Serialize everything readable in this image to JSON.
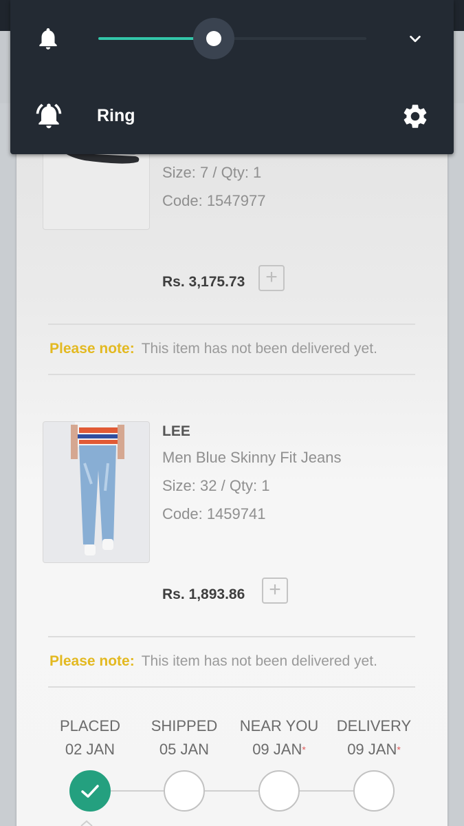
{
  "notification_panel": {
    "volume_level_fraction": 0.43,
    "ring_label": "Ring",
    "accent_color": "#33c6a9",
    "icons": [
      "bell-icon",
      "chevron-down-icon",
      "ringing-bell-icon",
      "gear-icon"
    ]
  },
  "items": [
    {
      "size_qty": "Size: 7 / Qty: 1",
      "code": "Code: 1547977",
      "price": "Rs. 3,175.73",
      "note_label": "Please note:",
      "note_text": "This item has not been delivered yet."
    },
    {
      "brand": "LEE",
      "name": "Men Blue Skinny Fit Jeans",
      "size_qty": "Size: 32 / Qty: 1",
      "code": "Code: 1459741",
      "price": "Rs. 1,893.86",
      "note_label": "Please note:",
      "note_text": "This item has not been delivered yet."
    }
  ],
  "tracking": {
    "steps": [
      {
        "label": "PLACED",
        "date": "02 JAN",
        "star": "",
        "done": true
      },
      {
        "label": "SHIPPED",
        "date": "05 JAN",
        "star": "",
        "done": false
      },
      {
        "label": "NEAR YOU",
        "date": "09 JAN",
        "star": "*",
        "done": false
      },
      {
        "label": "DELIVERY",
        "date": "09 JAN",
        "star": "*",
        "done": false
      }
    ]
  },
  "colors": {
    "note_label": "#e3b921",
    "done_step": "#24a07f",
    "star": "#e05b5b"
  },
  "plus_symbol": "+"
}
